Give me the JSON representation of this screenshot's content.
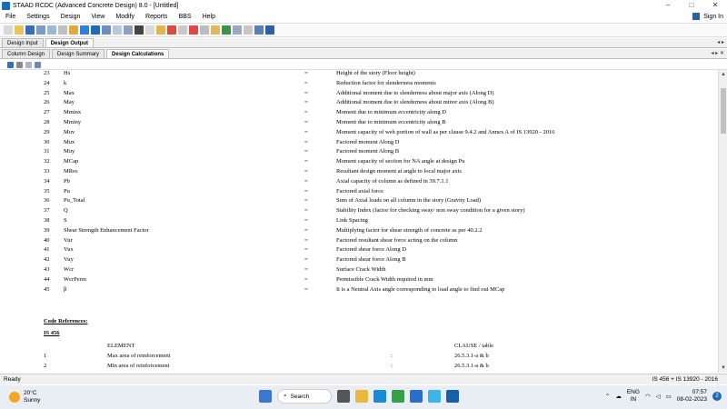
{
  "window": {
    "title": "STAAD RCDC (Advanced Concrete Design) 8.0 - [Untitled]",
    "controls": [
      "–",
      "□",
      "✕"
    ]
  },
  "menu": {
    "items": [
      "File",
      "Settings",
      "Design",
      "View",
      "Modify",
      "Reports",
      "BBS",
      "Help"
    ],
    "sign_in": "Sign In"
  },
  "tabs_primary": [
    "Design Input",
    "Design Output"
  ],
  "tabs_primary_active": "Design Output",
  "tabs_secondary": [
    "Column Design",
    "Design Summary",
    "Design Calculations"
  ],
  "tabs_secondary_active": "Design Calculations",
  "notations": [
    {
      "num": "23",
      "sym": "Hs",
      "eq": "=",
      "desc": "Height of the story (Floor height)"
    },
    {
      "num": "24",
      "sym": "k",
      "eq": "=",
      "desc": "Reduction factor for slenderness moments"
    },
    {
      "num": "25",
      "sym": "Max",
      "eq": "=",
      "desc": "Additional moment due to slenderness about major axis (Along D)"
    },
    {
      "num": "26",
      "sym": "May",
      "eq": "=",
      "desc": "Additional moment due to slenderness about minor axis (Along B)"
    },
    {
      "num": "27",
      "sym": "Mminx",
      "eq": "=",
      "desc": "Moment due to minimum eccentricity along D"
    },
    {
      "num": "28",
      "sym": "Mminy",
      "eq": "=",
      "desc": "Moment due to minimum eccentricity along B"
    },
    {
      "num": "29",
      "sym": "Muv",
      "eq": "=",
      "desc": "Moment capacity of web portion of wall as per clause 9.4.2 and Annex A of IS 13920 - 2016"
    },
    {
      "num": "30",
      "sym": "Mux",
      "eq": "=",
      "desc": "Factored moment Along D"
    },
    {
      "num": "31",
      "sym": "Muy",
      "eq": "=",
      "desc": "Factored moment Along B"
    },
    {
      "num": "32",
      "sym": "MCap",
      "eq": "=",
      "desc": "Moment capacity of section for NA angle at design Pu"
    },
    {
      "num": "33",
      "sym": "MRes",
      "eq": "=",
      "desc": "Resultant design moment at angle to local major axis"
    },
    {
      "num": "34",
      "sym": "Pb",
      "eq": "=",
      "desc": "Axial capacity of column as defined in 39.7.1.1"
    },
    {
      "num": "35",
      "sym": "Pu",
      "eq": "=",
      "desc": "Factored axial force"
    },
    {
      "num": "36",
      "sym": "Pu_Total",
      "eq": "=",
      "desc": "Sum of Axial loads on all column in the story (Gravity Load)"
    },
    {
      "num": "37",
      "sym": "Q",
      "eq": "=",
      "desc": "Stability Index (factor for checking sway/ non sway condition for a given story)"
    },
    {
      "num": "38",
      "sym": "S",
      "eq": "=",
      "desc": "Link Spacing"
    },
    {
      "num": "39",
      "sym": "Shear Strength Enhancement Factor",
      "eq": "=",
      "desc": "Multiplying factor for shear strength of concrete as per 40.2.2"
    },
    {
      "num": "40",
      "sym": "Vur",
      "eq": "=",
      "desc": "Factored resultant shear force acting on the column"
    },
    {
      "num": "41",
      "sym": "Vux",
      "eq": "=",
      "desc": "Factored shear force Along D"
    },
    {
      "num": "42",
      "sym": "Vuy",
      "eq": "=",
      "desc": "Factored shear force Along B"
    },
    {
      "num": "43",
      "sym": "Wcr",
      "eq": "=",
      "desc": "Surface Crack Width"
    },
    {
      "num": "44",
      "sym": "WcrPerm",
      "eq": "=",
      "desc": "Permissible Crack Width required in mm"
    },
    {
      "num": "45",
      "sym": "β",
      "eq": "=",
      "desc": "It is a Neutral Axis angle corresponding to load angle to find out MCap"
    }
  ],
  "code_refs": {
    "heading": "Code References:",
    "standard": "IS 456",
    "col_element": "ELEMENT",
    "col_clause": "CLAUSE / table",
    "rows": [
      {
        "num": "1",
        "element": "Max area of reinforcement",
        "sep": ":",
        "clause": "26.5.3.1-a & b"
      },
      {
        "num": "2",
        "element": "Min area of reinforcement",
        "sep": ":",
        "clause": "26.5.3.1-a & b"
      }
    ]
  },
  "status": {
    "left": "Ready",
    "right": "IS 456 + IS 13920 - 2016"
  },
  "taskbar": {
    "temp": "20°C",
    "weather": "Sunny",
    "search": "Search",
    "lang1": "ENG",
    "lang2": "IN",
    "time": "07:57",
    "date": "08-02-2023",
    "badge": "2"
  },
  "colors": {
    "accent": "#1e6bb8",
    "statusbar": "#f0f0f0",
    "taskbar": "#e9eef5"
  }
}
